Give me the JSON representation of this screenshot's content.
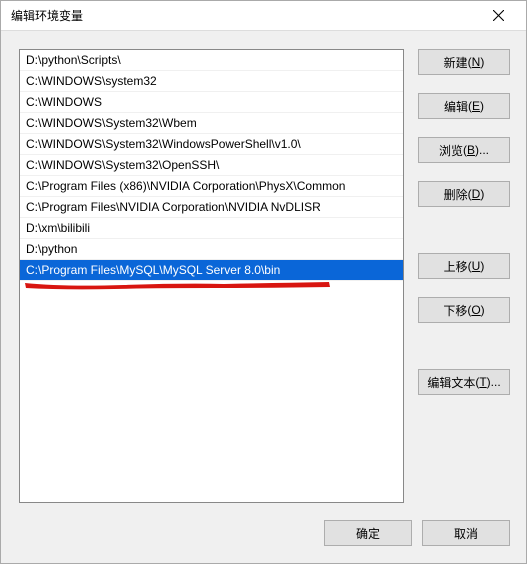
{
  "titlebar": {
    "title": "编辑环境变量"
  },
  "list": {
    "items": [
      "D:\\python\\Scripts\\",
      "C:\\WINDOWS\\system32",
      "C:\\WINDOWS",
      "C:\\WINDOWS\\System32\\Wbem",
      "C:\\WINDOWS\\System32\\WindowsPowerShell\\v1.0\\",
      "C:\\WINDOWS\\System32\\OpenSSH\\",
      "C:\\Program Files (x86)\\NVIDIA Corporation\\PhysX\\Common",
      "C:\\Program Files\\NVIDIA Corporation\\NVIDIA NvDLISR",
      "D:\\xm\\bilibili",
      "D:\\python",
      "C:\\Program Files\\MySQL\\MySQL Server 8.0\\bin"
    ],
    "selected_index": 10
  },
  "buttons": {
    "new_label": "新建",
    "new_key": "N",
    "edit_label": "编辑",
    "edit_key": "E",
    "browse_label": "浏览",
    "browse_key": "B",
    "browse_suffix": "...",
    "delete_label": "删除",
    "delete_key": "D",
    "moveup_label": "上移",
    "moveup_key": "U",
    "movedown_label": "下移",
    "movedown_key": "O",
    "edittext_label": "编辑文本",
    "edittext_key": "T",
    "edittext_suffix": "..."
  },
  "footer": {
    "ok_label": "确定",
    "cancel_label": "取消"
  }
}
